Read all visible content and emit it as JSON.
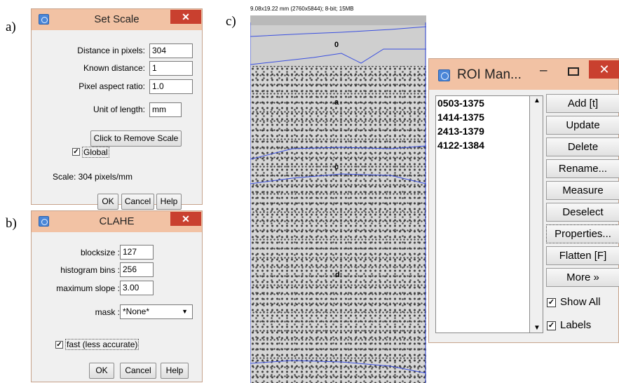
{
  "panel_labels": {
    "a": "a)",
    "b": "b)",
    "c": "c)"
  },
  "set_scale": {
    "title": "Set Scale",
    "close": "✕",
    "fields": [
      {
        "label": "Distance in pixels:",
        "value": "304"
      },
      {
        "label": "Known distance:",
        "value": "1"
      },
      {
        "label": "Pixel aspect ratio:",
        "value": "1.0"
      },
      {
        "label": "Unit of length:",
        "value": "mm"
      }
    ],
    "remove_scale_label": "Click to Remove Scale",
    "global_label": "Global",
    "global_checked": true,
    "scale_text": "Scale: 304 pixels/mm",
    "ok_label": "OK",
    "cancel_label": "Cancel",
    "help_label": "Help"
  },
  "clahe": {
    "title": "CLAHE",
    "close": "✕",
    "fields": [
      {
        "label": "blocksize :",
        "value": "127"
      },
      {
        "label": "histogram bins :",
        "value": "256"
      },
      {
        "label": "maximum slope :",
        "value": "3.00"
      }
    ],
    "mask_label": "mask :",
    "mask_value": "*None*",
    "fast_label": "fast (less accurate)",
    "fast_checked": true,
    "ok_label": "OK",
    "cancel_label": "Cancel",
    "help_label": "Help"
  },
  "image": {
    "info": "9.08x19.22 mm (2760x5844); 8-bit; 15MB",
    "roi_labels": [
      "0",
      "a",
      "c",
      "d"
    ]
  },
  "roi_manager": {
    "title": "ROI Man...",
    "minimize": "–",
    "close": "✕",
    "items": [
      "0503-1375",
      "1414-1375",
      "2413-1379",
      "4122-1384"
    ],
    "buttons": [
      "Add [t]",
      "Update",
      "Delete",
      "Rename...",
      "Measure",
      "Deselect",
      "Properties...",
      "Flatten [F]",
      "More »"
    ],
    "show_all_label": "Show All",
    "labels_label": "Labels",
    "check_mark": "✓",
    "scroll_up": "▲",
    "scroll_down": "▼"
  },
  "colors": {
    "titlebar": "#f2c2a4",
    "close_button": "#c9402f",
    "roi_line": "#3a4fe0"
  }
}
